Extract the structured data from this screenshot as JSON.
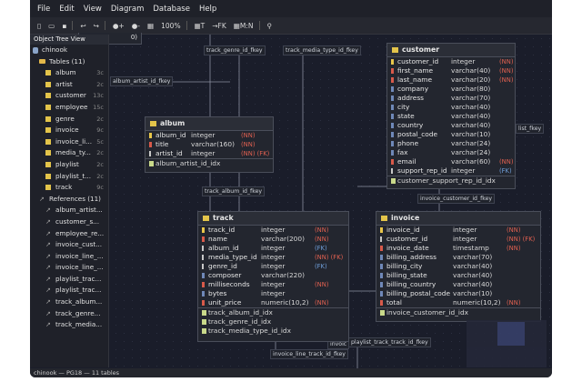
{
  "menu": [
    "File",
    "Edit",
    "View",
    "Diagram",
    "Database",
    "Help"
  ],
  "toolbar": {
    "zoom": "100%",
    "t_label": "T",
    "fk_label": "→FK",
    "mn_label": "M:N"
  },
  "tree": {
    "title": "Object Tree View",
    "db": "chinook",
    "tables_label": "Tables (11)",
    "tables": [
      {
        "name": "album",
        "count": "3c"
      },
      {
        "name": "artist",
        "count": "2c"
      },
      {
        "name": "customer",
        "count": "13c"
      },
      {
        "name": "employee",
        "count": "15c"
      },
      {
        "name": "genre",
        "count": "2c"
      },
      {
        "name": "invoice",
        "count": "9c"
      },
      {
        "name": "invoice_li...",
        "count": "5c"
      },
      {
        "name": "media_ty...",
        "count": "2c"
      },
      {
        "name": "playlist",
        "count": "2c"
      },
      {
        "name": "playlist_t...",
        "count": "2c"
      },
      {
        "name": "track",
        "count": "9c"
      }
    ],
    "refs_label": "References (11)",
    "refs": [
      "album_artist...",
      "customer_s...",
      "employee_re...",
      "invoice_cust...",
      "invoice_line_...",
      "invoice_line_...",
      "playlist_trac...",
      "playlist_trac...",
      "track_album...",
      "track_genre...",
      "track_media..."
    ]
  },
  "status": "chinook — PG18 — 11 tables",
  "relations": {
    "r1": "track_genre_id_fkey",
    "r2": "track_media_type_id_fkey",
    "r3": "album_artist_id_fkey",
    "r4": "track_album_id_fkey",
    "r5": "invoice_customer_id_fkey",
    "r6": "invoice_line_track_id_fkey",
    "r7": "invoic",
    "r8": "playlist_track_track_id_fkey",
    "r9": "list_fkey",
    "r10": "0)"
  },
  "customer": {
    "title": "customer",
    "cols": [
      {
        "n": "customer_id",
        "t": "integer",
        "f": "(NN)",
        "k": "pk"
      },
      {
        "n": "first_name",
        "t": "varchar(40)",
        "f": "(NN)",
        "k": "nn"
      },
      {
        "n": "last_name",
        "t": "varchar(20)",
        "f": "(NN)",
        "k": "nn"
      },
      {
        "n": "company",
        "t": "varchar(80)",
        "f": "",
        "k": ""
      },
      {
        "n": "address",
        "t": "varchar(70)",
        "f": "",
        "k": ""
      },
      {
        "n": "city",
        "t": "varchar(40)",
        "f": "",
        "k": ""
      },
      {
        "n": "state",
        "t": "varchar(40)",
        "f": "",
        "k": ""
      },
      {
        "n": "country",
        "t": "varchar(40)",
        "f": "",
        "k": ""
      },
      {
        "n": "postal_code",
        "t": "varchar(10)",
        "f": "",
        "k": ""
      },
      {
        "n": "phone",
        "t": "varchar(24)",
        "f": "",
        "k": ""
      },
      {
        "n": "fax",
        "t": "varchar(24)",
        "f": "",
        "k": ""
      },
      {
        "n": "email",
        "t": "varchar(60)",
        "f": "(NN)",
        "k": "nn"
      },
      {
        "n": "support_rep_id",
        "t": "integer",
        "f": "(FK)",
        "k": "fk"
      }
    ],
    "idx": [
      "customer_support_rep_id_idx"
    ]
  },
  "album": {
    "title": "album",
    "cols": [
      {
        "n": "album_id",
        "t": "integer",
        "f": "(NN)",
        "k": "pk"
      },
      {
        "n": "title",
        "t": "varchar(160)",
        "f": "(NN)",
        "k": "nn"
      },
      {
        "n": "artist_id",
        "t": "integer",
        "f": "(NN) (FK)",
        "k": "fk"
      }
    ],
    "idx": [
      "album_artist_id_idx"
    ]
  },
  "track": {
    "title": "track",
    "cols": [
      {
        "n": "track_id",
        "t": "integer",
        "f": "(NN)",
        "k": "pk"
      },
      {
        "n": "name",
        "t": "varchar(200)",
        "f": "(NN)",
        "k": "nn"
      },
      {
        "n": "album_id",
        "t": "integer",
        "f": "(FK)",
        "k": "fk"
      },
      {
        "n": "media_type_id",
        "t": "integer",
        "f": "(NN) (FK)",
        "k": "fk"
      },
      {
        "n": "genre_id",
        "t": "integer",
        "f": "(FK)",
        "k": "fk"
      },
      {
        "n": "composer",
        "t": "varchar(220)",
        "f": "",
        "k": ""
      },
      {
        "n": "milliseconds",
        "t": "integer",
        "f": "(NN)",
        "k": "nn"
      },
      {
        "n": "bytes",
        "t": "integer",
        "f": "",
        "k": ""
      },
      {
        "n": "unit_price",
        "t": "numeric(10,2)",
        "f": "(NN)",
        "k": "nn"
      }
    ],
    "idx": [
      "track_album_id_idx",
      "track_genre_id_idx",
      "track_media_type_id_idx"
    ]
  },
  "invoice": {
    "title": "invoice",
    "cols": [
      {
        "n": "invoice_id",
        "t": "integer",
        "f": "(NN)",
        "k": "pk"
      },
      {
        "n": "customer_id",
        "t": "integer",
        "f": "(NN) (FK)",
        "k": "fk"
      },
      {
        "n": "invoice_date",
        "t": "timestamp",
        "f": "(NN)",
        "k": "nn"
      },
      {
        "n": "billing_address",
        "t": "varchar(70)",
        "f": "",
        "k": ""
      },
      {
        "n": "billing_city",
        "t": "varchar(40)",
        "f": "",
        "k": ""
      },
      {
        "n": "billing_state",
        "t": "varchar(40)",
        "f": "",
        "k": ""
      },
      {
        "n": "billing_country",
        "t": "varchar(40)",
        "f": "",
        "k": ""
      },
      {
        "n": "billing_postal_code",
        "t": "varchar(10)",
        "f": "",
        "k": ""
      },
      {
        "n": "total",
        "t": "numeric(10,2)",
        "f": "(NN)",
        "k": "nn"
      }
    ],
    "idx": [
      "invoice_customer_id_idx"
    ]
  }
}
